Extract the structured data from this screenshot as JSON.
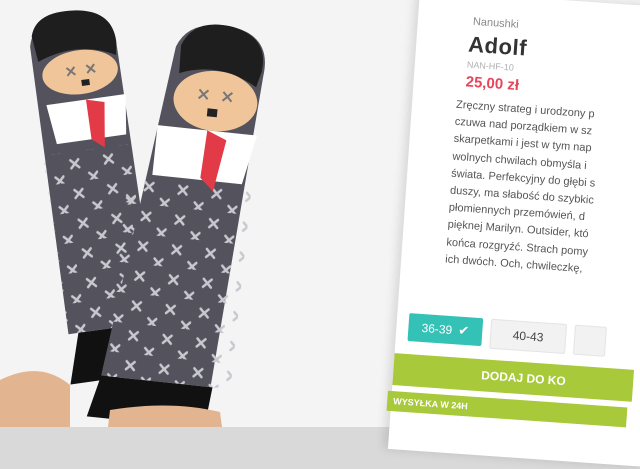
{
  "product": {
    "brand": "Nanushki",
    "name": "Adolf",
    "sku": "NAN-HF-10",
    "price": "25,00 zł",
    "description": [
      "Zręczny strateg i urodzony p",
      "czuwa nad porządkiem w sz",
      "skarpetkami i jest w tym nap",
      "wolnych chwilach obmyśla i",
      "świata. Perfekcyjny do głębi s",
      "duszy, ma słabość do szybkic",
      "płomiennych przemówień, d",
      "pięknej Marilyn. Outsider, któ",
      "końca rozgryźć. Strach pomy",
      "ich dwóch. Och, chwileczkę,"
    ]
  },
  "sizes": [
    {
      "label": "36-39",
      "selected": true,
      "icon": "check-icon"
    },
    {
      "label": "40-43",
      "selected": false
    },
    {
      "label": "",
      "selected": false
    }
  ],
  "actions": {
    "add_to_cart": "DODAJ DO KO",
    "shipping": "WYSYŁKA W 24H"
  },
  "colors": {
    "accent_teal": "#35c2b6",
    "price_red": "#e8455a",
    "cta_green": "#a8c93a",
    "sock_grey": "#54535d"
  }
}
